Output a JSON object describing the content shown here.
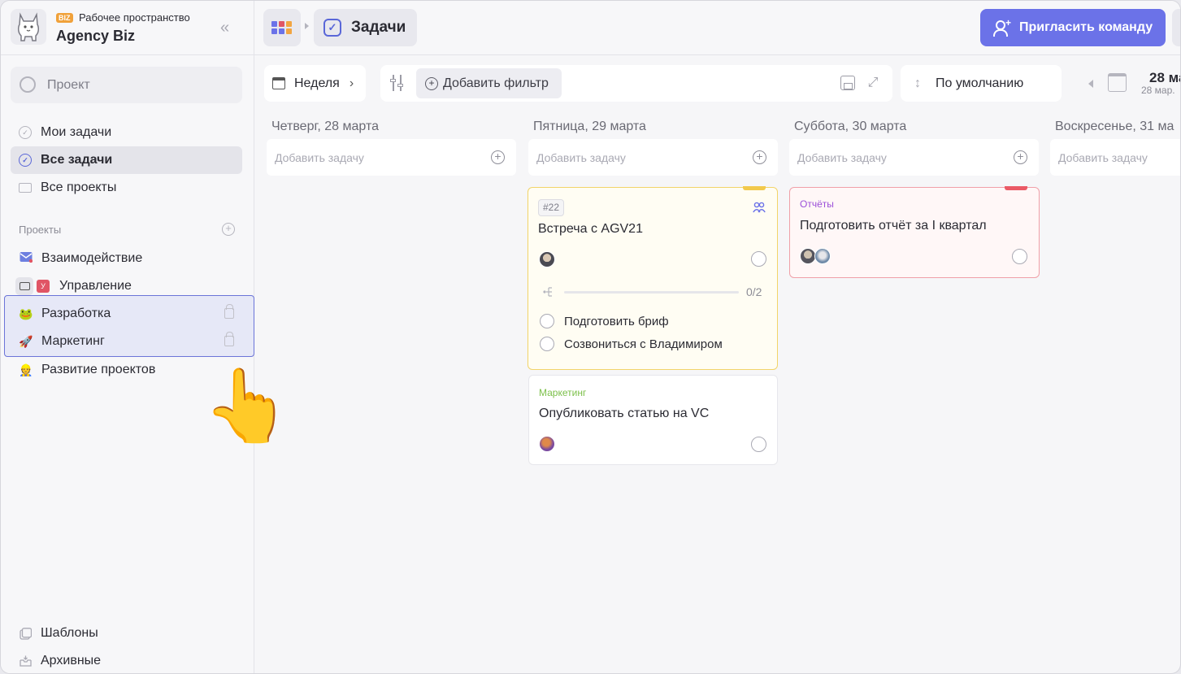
{
  "workspace": {
    "badge": "BIZ",
    "subtitle": "Рабочее пространство",
    "title": "Agency Biz"
  },
  "sidebar": {
    "search_placeholder": "Проект",
    "nav": [
      {
        "label": "Мои задачи"
      },
      {
        "label": "Все задачи"
      },
      {
        "label": "Все проекты"
      }
    ],
    "section_title": "Проекты",
    "projects": [
      {
        "label": "Взаимодействие",
        "icon": "envelope-icon"
      },
      {
        "label": "Управление",
        "badge": "У",
        "icon": "folder-icon"
      },
      {
        "label": "Разработка",
        "icon": "frog-icon",
        "locked": true
      },
      {
        "label": "Маркетинг",
        "icon": "rocket-icon",
        "locked": true
      },
      {
        "label": "Развитие проектов",
        "icon": "construction-worker-icon"
      }
    ],
    "bottom": [
      {
        "label": "Шаблоны"
      },
      {
        "label": "Архивные"
      }
    ]
  },
  "topbar": {
    "tab_label": "Задачи",
    "invite_label": "Пригласить команду",
    "accent": "#6b72e8"
  },
  "toolbar": {
    "view_label": "Неделя",
    "add_filter_label": "Добавить фильтр",
    "sort_label": "По умолчанию",
    "date_big": "28 ма",
    "date_small": "28 мар."
  },
  "columns": [
    {
      "title": "Четверг, 28 марта",
      "add_placeholder": "Добавить задачу"
    },
    {
      "title": "Пятница, 29 марта",
      "add_placeholder": "Добавить задачу"
    },
    {
      "title": "Суббота, 30 марта",
      "add_placeholder": "Добавить задачу"
    },
    {
      "title": "Воскресенье, 31 ма",
      "add_placeholder": "Добавить задачу"
    }
  ],
  "cards": {
    "meeting": {
      "number": "#22",
      "title": "Встреча с AGV21",
      "progress_text": "0/2",
      "progress": 0,
      "subtasks": [
        {
          "label": "Подготовить бриф"
        },
        {
          "label": "Созвониться с Владимиром"
        }
      ],
      "tag_color": "#f2c94c"
    },
    "article": {
      "project": "Маркетинг",
      "project_color": "#7cc04a",
      "title": "Опубликовать статью на VC"
    },
    "report": {
      "project": "Отчёты",
      "project_color": "#9b4fd8",
      "title": "Подготовить отчёт за I квартал",
      "tag_color": "#ea5a66"
    }
  }
}
